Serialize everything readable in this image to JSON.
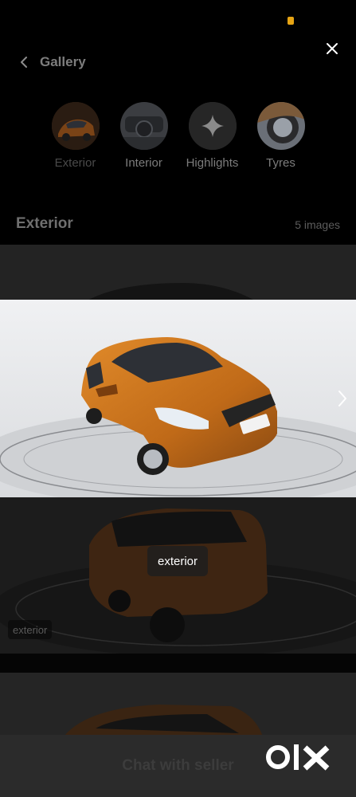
{
  "header": {
    "title": "Gallery"
  },
  "tabs": [
    {
      "label": "Exterior",
      "active": true
    },
    {
      "label": "Interior",
      "active": false
    },
    {
      "label": "Highlights",
      "active": false
    },
    {
      "label": "Tyres",
      "active": false
    }
  ],
  "section": {
    "title": "Exterior",
    "count": "5 images"
  },
  "viewer": {
    "caption": "exterior"
  },
  "gallery_tag": "exterior",
  "cta": {
    "label": "Chat with seller"
  },
  "brand": {
    "logo": "OLX"
  },
  "colors": {
    "accent": "#e6a414",
    "car_orange": "#c8741f",
    "overlay": "#000000"
  }
}
